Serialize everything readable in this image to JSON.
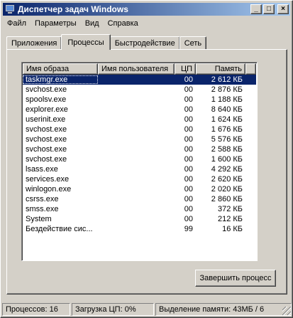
{
  "window": {
    "title": "Диспетчер задач Windows"
  },
  "title_buttons": {
    "minimize": "_",
    "maximize": "□",
    "close": "×"
  },
  "menu": [
    "Файл",
    "Параметры",
    "Вид",
    "Справка"
  ],
  "tabs": [
    {
      "label": "Приложения",
      "active": false
    },
    {
      "label": "Процессы",
      "active": true
    },
    {
      "label": "Быстродействие",
      "active": false
    },
    {
      "label": "Сеть",
      "active": false
    }
  ],
  "table": {
    "columns": [
      "Имя образа",
      "Имя пользователя",
      "ЦП",
      "Память"
    ],
    "rows": [
      {
        "name": "taskmgr.exe",
        "user": "",
        "cpu": "00",
        "mem": "2 612 КБ",
        "selected": true
      },
      {
        "name": "svchost.exe",
        "user": "",
        "cpu": "00",
        "mem": "2 876 КБ"
      },
      {
        "name": "spoolsv.exe",
        "user": "",
        "cpu": "00",
        "mem": "1 188 КБ"
      },
      {
        "name": "explorer.exe",
        "user": "",
        "cpu": "00",
        "mem": "8 640 КБ"
      },
      {
        "name": "userinit.exe",
        "user": "",
        "cpu": "00",
        "mem": "1 624 КБ"
      },
      {
        "name": "svchost.exe",
        "user": "",
        "cpu": "00",
        "mem": "1 676 КБ"
      },
      {
        "name": "svchost.exe",
        "user": "",
        "cpu": "00",
        "mem": "5 576 КБ"
      },
      {
        "name": "svchost.exe",
        "user": "",
        "cpu": "00",
        "mem": "2 588 КБ"
      },
      {
        "name": "svchost.exe",
        "user": "",
        "cpu": "00",
        "mem": "1 600 КБ"
      },
      {
        "name": "lsass.exe",
        "user": "",
        "cpu": "00",
        "mem": "4 292 КБ"
      },
      {
        "name": "services.exe",
        "user": "",
        "cpu": "00",
        "mem": "2 620 КБ"
      },
      {
        "name": "winlogon.exe",
        "user": "",
        "cpu": "00",
        "mem": "2 020 КБ"
      },
      {
        "name": "csrss.exe",
        "user": "",
        "cpu": "00",
        "mem": "2 860 КБ"
      },
      {
        "name": "smss.exe",
        "user": "",
        "cpu": "00",
        "mem": "372 КБ"
      },
      {
        "name": "System",
        "user": "",
        "cpu": "00",
        "mem": "212 КБ"
      },
      {
        "name": "Бездействие сис...",
        "user": "",
        "cpu": "99",
        "mem": "16 КБ"
      }
    ]
  },
  "end_process_button": "Завершить процесс",
  "status": {
    "processes": "Процессов: 16",
    "cpu_load": "Загрузка ЦП: 0%",
    "memory": "Выделение памяти: 43МБ / 6"
  }
}
